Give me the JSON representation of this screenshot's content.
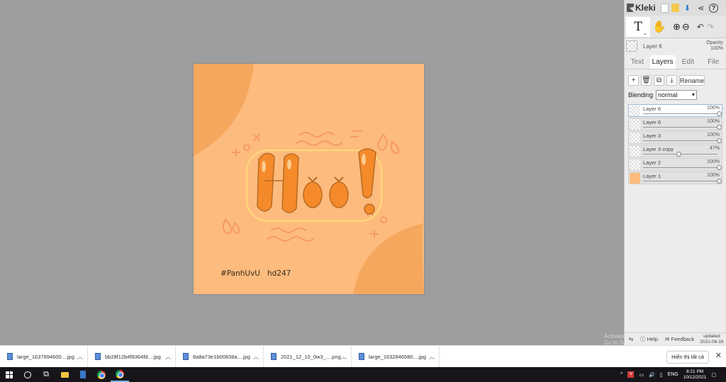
{
  "app": {
    "name": "Kleki"
  },
  "artwork": {
    "tag1": "#PanhUvU",
    "tag2": "hd247",
    "bg_color": "#fdbb7d",
    "accent_color": "#f5a75d",
    "letter_color": "#f58a2a"
  },
  "toolbar": {
    "text_tool": "T",
    "text_tool_caret": "⌄"
  },
  "current_layer": {
    "name": "Layer 6",
    "opacity_label": "Opacity",
    "opacity_value": "100%"
  },
  "tabs": [
    {
      "label": "Text",
      "active": false
    },
    {
      "label": "Layers",
      "active": true
    },
    {
      "label": "Edit",
      "active": false
    },
    {
      "label": "File",
      "active": false
    }
  ],
  "layer_buttons": {
    "add": "+",
    "rename": "Rename"
  },
  "blending": {
    "label": "Blending",
    "value": "normal"
  },
  "layers": [
    {
      "name": "Layer 6",
      "opacity": "100%",
      "opacity_value": 1.0,
      "selected": true,
      "thumb": "checker"
    },
    {
      "name": "Layer 6",
      "opacity": "100%",
      "opacity_value": 1.0,
      "selected": false,
      "thumb": "checker"
    },
    {
      "name": "Layer 3",
      "opacity": "100%",
      "opacity_value": 1.0,
      "selected": false,
      "thumb": "checker"
    },
    {
      "name": "Layer 3 copy",
      "opacity": "47%",
      "opacity_value": 0.47,
      "selected": false,
      "thumb": "checker"
    },
    {
      "name": "Layer 2",
      "opacity": "100%",
      "opacity_value": 1.0,
      "selected": false,
      "thumb": "checker"
    },
    {
      "name": "Layer 1",
      "opacity": "100%",
      "opacity_value": 1.0,
      "selected": false,
      "thumb": "solid"
    }
  ],
  "panel_footer": {
    "help": "Help",
    "feedback": "Feedback",
    "updated_label": "updated",
    "updated_date": "2021-06-16"
  },
  "watermark": {
    "line1": "Activate Windows",
    "line2": "Go to Settings to activate Windows."
  },
  "downloads": {
    "items": [
      {
        "name": "large_1637994600....jpg"
      },
      {
        "name": "bb28f12b4f9364fd....jpg"
      },
      {
        "name": "8a8a73e1b00838a....jpg"
      },
      {
        "name": "2021_12_10_0w3_....png"
      },
      {
        "name": "large_1632846580....jpg"
      }
    ],
    "show_all": "Hiển thị tất cả"
  },
  "taskbar": {
    "lang": "ENG",
    "time": "8:21 PM",
    "date": "10/12/2021"
  }
}
